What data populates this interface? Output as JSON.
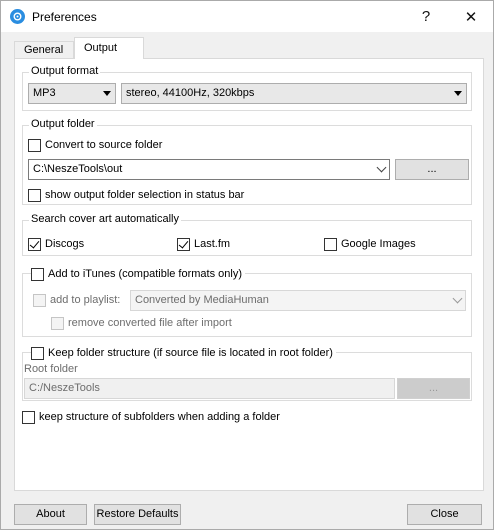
{
  "window": {
    "title": "Preferences",
    "help_glyph": "?",
    "close_glyph": "✕"
  },
  "tabs": [
    {
      "label": "General",
      "active": false
    },
    {
      "label": "Output",
      "active": true
    }
  ],
  "output_format": {
    "title": "Output format",
    "format_value": "MP3",
    "quality_value": "stereo, 44100Hz, 320kbps"
  },
  "output_folder": {
    "title": "Output folder",
    "convert_to_source": {
      "label": "Convert to source folder",
      "checked": false
    },
    "path_value": "C:\\NeszeTools\\out",
    "browse_label": "...",
    "show_in_status_bar": {
      "label": "show output folder selection in status bar",
      "checked": false
    }
  },
  "cover_art": {
    "title": "Search cover art automatically",
    "discogs": {
      "label": "Discogs",
      "checked": true
    },
    "lastfm": {
      "label": "Last.fm",
      "checked": true
    },
    "google_images": {
      "label": "Google Images",
      "checked": false
    }
  },
  "itunes": {
    "add_to_itunes": {
      "label": "Add to iTunes (compatible formats only)",
      "checked": false
    },
    "add_to_playlist": {
      "label": "add to playlist:",
      "checked": false
    },
    "playlist_value": "Converted by MediaHuman",
    "remove_after_import": {
      "label": "remove converted file after import",
      "checked": false
    }
  },
  "folder_structure": {
    "keep_structure": {
      "label": "Keep folder structure (if source file is located in root folder)",
      "checked": false
    },
    "root_folder_label": "Root folder",
    "root_folder_value": "C:/NeszeTools",
    "browse_label": "..."
  },
  "keep_subfolders": {
    "label": "keep structure of subfolders when adding a folder",
    "checked": false
  },
  "footer": {
    "about_label": "About",
    "restore_label": "Restore Defaults",
    "close_label": "Close"
  }
}
